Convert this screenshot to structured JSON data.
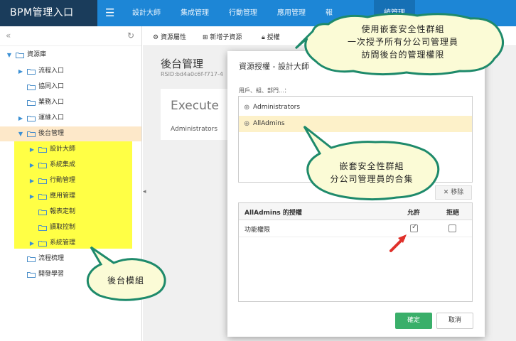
{
  "app": {
    "brand": "BPM管理入口"
  },
  "topnav": {
    "items": [
      "設計大師",
      "集成管理",
      "行動管理",
      "應用管理",
      "報",
      "統管理"
    ]
  },
  "sidebar": {
    "root": "資源庫",
    "items": [
      {
        "label": "流程入口"
      },
      {
        "label": "協同入口"
      },
      {
        "label": "業務入口"
      },
      {
        "label": "運維入口"
      },
      {
        "label": "後台管理"
      },
      {
        "label": "設計大師"
      },
      {
        "label": "系統集成"
      },
      {
        "label": "行動管理"
      },
      {
        "label": "應用管理"
      },
      {
        "label": "報表定制"
      },
      {
        "label": "讀取控制"
      },
      {
        "label": "系統管理"
      },
      {
        "label": "流程梳理"
      },
      {
        "label": "開發學習"
      }
    ]
  },
  "toolbar": {
    "props": "資源屬性",
    "new_child": "新增子資源",
    "grant": "授權"
  },
  "content": {
    "title": "後台管理",
    "rsid": "RSID:bd4a0c6f-f717-4",
    "exec_title": "Execute",
    "exec_sub": "Administrators"
  },
  "modal": {
    "title": "資源授權 - 設計大師",
    "users_label": "用戶、組、部門...：",
    "users": [
      "Administrators",
      "AllAdmins"
    ],
    "remove": "移除",
    "perm_header": "AllAdmins 的授權",
    "allow": "允許",
    "deny": "拒絕",
    "perm_rows": [
      {
        "name": "功能權限",
        "allow": true,
        "deny": false
      }
    ],
    "ok": "確定",
    "cancel": "取消"
  },
  "callouts": {
    "top_line1": "使用嵌套安全性群組",
    "top_line2": "一次授予所有分公司管理員",
    "top_line3": "訪問後台的管理權限",
    "mid_line1": "嵌套安全性群組",
    "mid_line2": "分公司管理員的合集",
    "left": "後台模組"
  },
  "colors": {
    "topbar": "#1d86d6",
    "brand_bg": "#1a3c5b",
    "callout_fill": "#fbfbd6",
    "callout_stroke": "#1e8a6b",
    "highlight_yellow": "#ffff45",
    "ok_button": "#3aaf6a",
    "arrow_red": "#e0302a"
  }
}
